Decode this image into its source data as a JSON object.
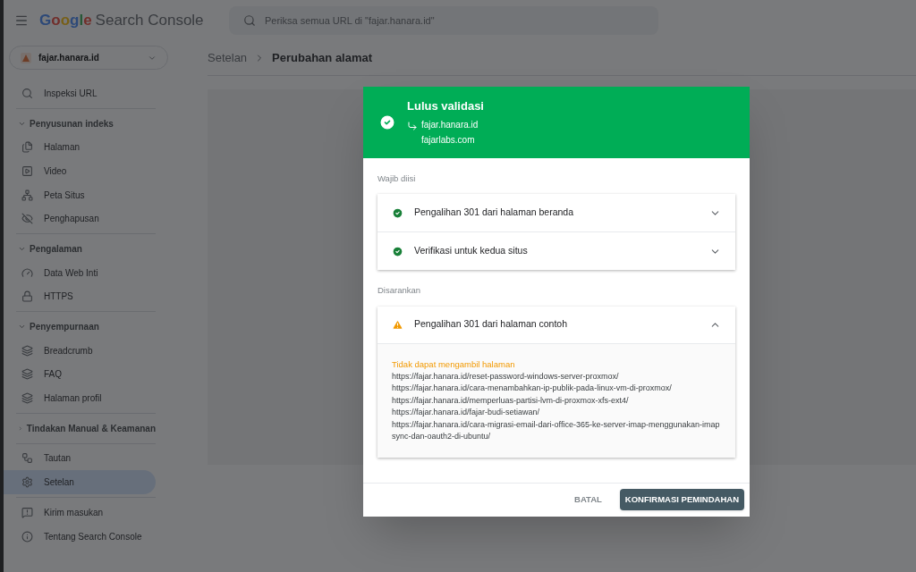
{
  "header": {
    "logo_word": "Google",
    "product": "Search Console",
    "search": {
      "placeholder": "Periksa semua URL di \"fajar.hanara.id\""
    }
  },
  "property": {
    "name": "fajar.hanara.id"
  },
  "sidebar": {
    "groups": [
      {
        "items": [
          {
            "label": "Inspeksi URL",
            "kind": "search",
            "selected": false
          }
        ]
      },
      {
        "title": "Penyusunan indeks",
        "expanded": true,
        "items": [
          {
            "label": "Halaman",
            "kind": "pages",
            "selected": false
          },
          {
            "label": "Video",
            "kind": "video",
            "selected": false
          },
          {
            "label": "Peta Situs",
            "kind": "sitemap",
            "selected": false
          },
          {
            "label": "Penghapusan",
            "kind": "hidden",
            "selected": false
          }
        ]
      },
      {
        "title": "Pengalaman",
        "expanded": true,
        "items": [
          {
            "label": "Data Web Inti",
            "kind": "gauge",
            "selected": false
          },
          {
            "label": "HTTPS",
            "kind": "lock",
            "selected": false
          }
        ]
      },
      {
        "title": "Penyempurnaan",
        "expanded": true,
        "items": [
          {
            "label": "Breadcrumb",
            "kind": "layers",
            "selected": false
          },
          {
            "label": "FAQ",
            "kind": "layers",
            "selected": false
          },
          {
            "label": "Halaman profil",
            "kind": "layers",
            "selected": false
          }
        ]
      },
      {
        "title": "Tindakan Manual & Keamanan",
        "expanded": false
      },
      {
        "items": [
          {
            "label": "Tautan",
            "kind": "network",
            "selected": false
          },
          {
            "label": "Setelan",
            "kind": "gear",
            "selected": true
          }
        ]
      },
      {
        "items": [
          {
            "label": "Kirim masukan",
            "kind": "feedback",
            "selected": false
          },
          {
            "label": "Tentang Search Console",
            "kind": "info",
            "selected": false
          }
        ]
      }
    ]
  },
  "breadcrumb": [
    "Setelan",
    "Perubahan alamat"
  ],
  "dialog": {
    "title": "Lulus validasi",
    "from": "fajar.hanara.id",
    "to": "fajarlabs.com",
    "sections": [
      {
        "title": "Wajib diisi",
        "checks": [
          {
            "label": "Pengalihan 301 dari halaman beranda",
            "kind": "pass",
            "expanded": false
          },
          {
            "label": "Verifikasi untuk kedua situs",
            "kind": "pass",
            "expanded": false
          }
        ]
      },
      {
        "title": "Disarankan",
        "checks": [
          {
            "label": "Pengalihan 301 dari halaman contoh",
            "kind": "warning",
            "expanded": true,
            "detail_title": "Tidak dapat mengambil halaman",
            "urls": [
              "https://fajar.hanara.id/reset-password-windows-server-proxmox/",
              "https://fajar.hanara.id/cara-menambahkan-ip-publik-pada-linux-vm-di-proxmox/",
              "https://fajar.hanara.id/memperluas-partisi-lvm-di-proxmox-xfs-ext4/",
              "https://fajar.hanara.id/fajar-budi-setiawan/",
              "https://fajar.hanara.id/cara-migrasi-email-dari-office-365-ke-server-imap-menggunakan-imapsync-dan-oauth2-di-ubuntu/"
            ]
          }
        ]
      }
    ],
    "cancel": "BATAL",
    "confirm": "KONFIRMASI PEMINDAHAN"
  }
}
